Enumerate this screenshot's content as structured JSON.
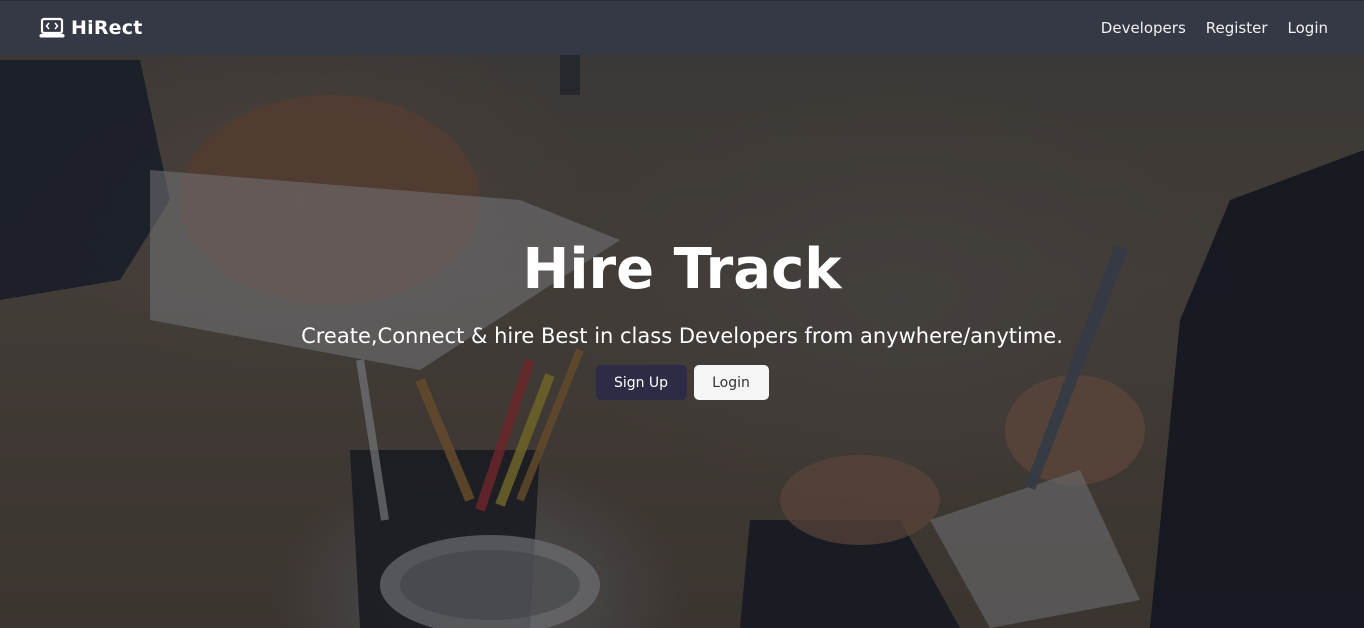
{
  "navbar": {
    "brand": "HiRect",
    "brand_icon": "laptop-code-icon",
    "links": [
      {
        "label": "Developers"
      },
      {
        "label": "Register"
      },
      {
        "label": "Login"
      }
    ]
  },
  "hero": {
    "title": "Hire Track",
    "subtitle": "Create,Connect & hire Best in class Developers from anywhere/anytime.",
    "signup_label": "Sign Up",
    "login_label": "Login"
  },
  "colors": {
    "navbar_bg": "#343a46",
    "signup_bg": "#2d2b45",
    "login_bg": "#f5f5f5",
    "text": "#ffffff"
  }
}
